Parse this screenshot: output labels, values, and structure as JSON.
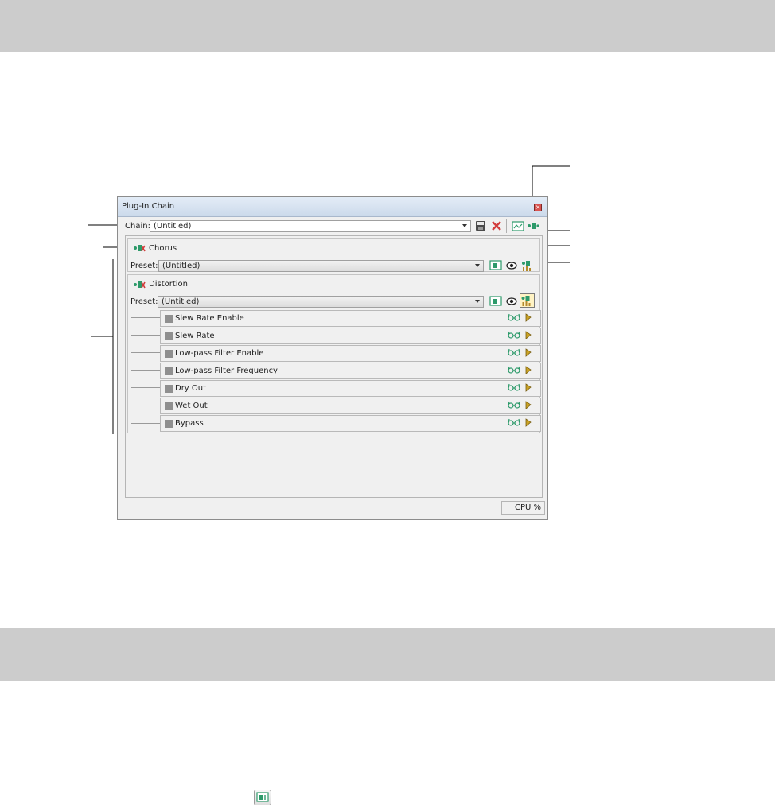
{
  "window": {
    "title": "Plug-In Chain",
    "close_glyph": "×"
  },
  "chain": {
    "label": "Chain:",
    "value": "(Untitled)"
  },
  "plugins": [
    {
      "name": "Chorus",
      "preset_label": "Preset:",
      "preset_value": "(Untitled)"
    },
    {
      "name": "Distortion",
      "preset_label": "Preset:",
      "preset_value": "(Untitled)"
    }
  ],
  "parameters": [
    "Slew Rate Enable",
    "Slew Rate",
    "Low-pass Filter Enable",
    "Low-pass Filter Frequency",
    "Dry Out",
    "Wet Out",
    "Bypass"
  ],
  "status": {
    "cpu_label": "CPU %"
  },
  "icons": {
    "save": "save-icon",
    "delete": "delete-icon",
    "add_envelope": "add-envelope-icon",
    "add_plugin": "add-plugin-icon",
    "plugin": "plugin-icon",
    "show_ui": "eye-icon",
    "edit_plugin": "plugin-edit-icon",
    "automate": "glasses-icon",
    "keyframe": "keyframe-icon"
  },
  "colors": {
    "band": "#cccccc",
    "icon_green": "#2d9a6a",
    "icon_red": "#d33c3c"
  }
}
